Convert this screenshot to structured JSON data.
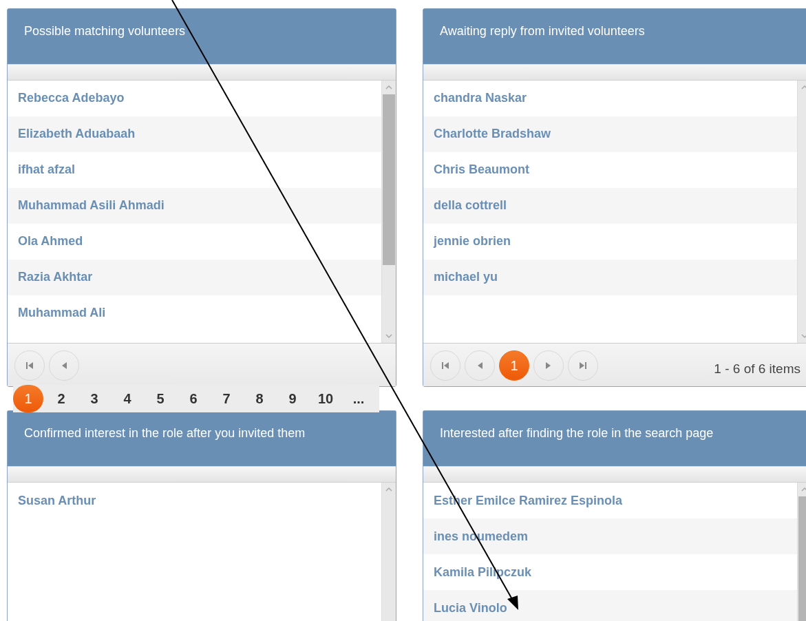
{
  "panels": [
    {
      "title": "Possible matching volunteers",
      "scrollable": true,
      "rows": [
        "Rebecca Adebayo",
        "Elizabeth Aduabaah",
        "ifhat afzal",
        "Muhammad Asili Ahmadi",
        "Ola Ahmed",
        "Razia Akhtar",
        "Muhammad Ali"
      ],
      "pager": {
        "items": [
          {
            "kind": "first"
          },
          {
            "kind": "prev"
          }
        ],
        "pages": [
          {
            "label": "1",
            "selected": true
          },
          {
            "label": "2",
            "selected": false
          },
          {
            "label": "3",
            "selected": false
          },
          {
            "label": "4",
            "selected": false
          },
          {
            "label": "5",
            "selected": false
          },
          {
            "label": "6",
            "selected": false
          },
          {
            "label": "7",
            "selected": false
          },
          {
            "label": "8",
            "selected": false
          },
          {
            "label": "9",
            "selected": false
          },
          {
            "label": "10",
            "selected": false
          },
          {
            "label": "...",
            "selected": false
          }
        ]
      }
    },
    {
      "title": "Awaiting reply from invited volunteers",
      "scrollable": false,
      "rows": [
        "chandra Naskar",
        "Charlotte Bradshaw",
        "Chris Beaumont",
        "della cottrell",
        "jennie obrien",
        "michael yu"
      ],
      "pager": {
        "items": [
          {
            "kind": "first"
          },
          {
            "kind": "prev"
          },
          {
            "kind": "page",
            "label": "1",
            "selected": true
          },
          {
            "kind": "next"
          },
          {
            "kind": "last"
          }
        ],
        "summary": "1 - 6 of 6 items"
      }
    },
    {
      "title": "Confirmed interest in the role after you invited them",
      "scrollable": false,
      "rows": [
        "Susan Arthur"
      ]
    },
    {
      "title": "Interested after finding the role in the search page",
      "scrollable": true,
      "rows": [
        "Esther Emilce Ramirez Espinola",
        "ines noumedem",
        "Kamila Pilipczuk",
        "Lucia Vinolo"
      ]
    }
  ],
  "annotation": {
    "kind": "arrow"
  }
}
